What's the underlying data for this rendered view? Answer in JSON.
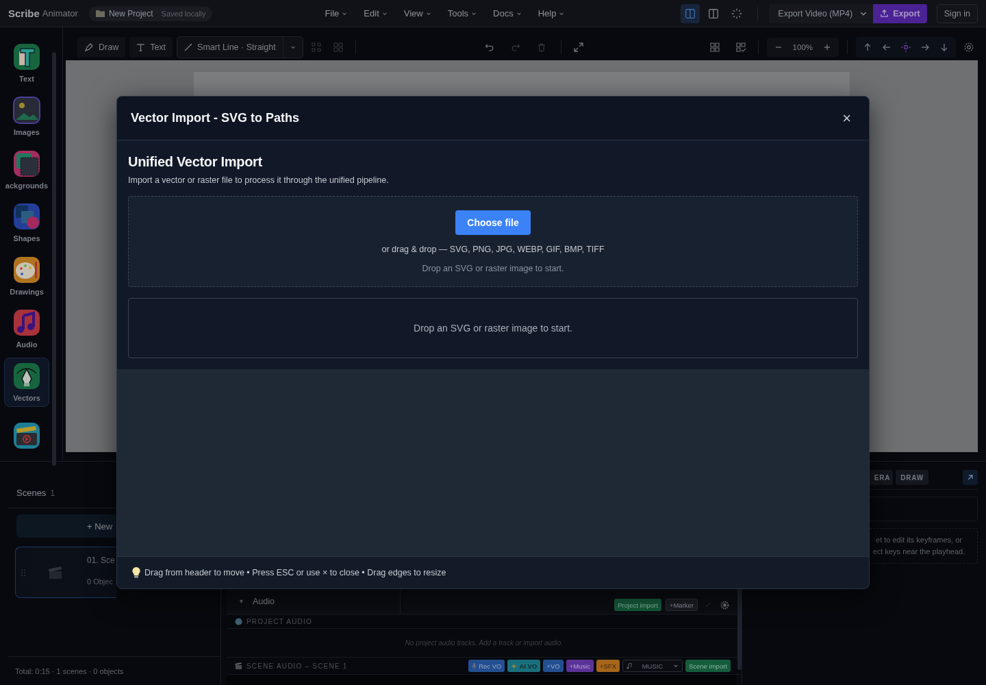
{
  "header": {
    "brand": "Scribe",
    "brand_sub": "Animator",
    "project": "New Project",
    "project_status": "Saved locally",
    "menus": [
      "File",
      "Edit",
      "View",
      "Tools",
      "Docs",
      "Help"
    ],
    "layout_buttons": [
      {
        "kind": "split",
        "selected": true
      },
      {
        "kind": "columns",
        "selected": false
      },
      {
        "kind": "loader",
        "selected": false
      }
    ],
    "export_format": "Export Video (MP4)",
    "export_button": "Export",
    "sign_in": "Sign in"
  },
  "toolbar": {
    "tools": [
      {
        "kind": "draw",
        "label": "Draw"
      },
      {
        "kind": "text",
        "label": "Text"
      }
    ],
    "smart_line": "Smart Line · Straight",
    "history": [
      {
        "kind": "undo",
        "disabled": false
      },
      {
        "kind": "redo",
        "disabled": true
      },
      {
        "kind": "delete",
        "disabled": true
      }
    ],
    "zoom": "100%"
  },
  "sidebar": {
    "items": [
      {
        "kind": "text",
        "label": "Text",
        "selected": false
      },
      {
        "kind": "images",
        "label": "Images",
        "selected": false
      },
      {
        "kind": "backgrounds",
        "label": "ackgrounds",
        "selected": false
      },
      {
        "kind": "shapes",
        "label": "Shapes",
        "selected": false
      },
      {
        "kind": "drawings",
        "label": "Drawings",
        "selected": false
      },
      {
        "kind": "audio",
        "label": "Audio",
        "selected": false
      },
      {
        "kind": "vectors",
        "label": "Vectors",
        "selected": true
      },
      {
        "kind": "video",
        "selected": false
      }
    ]
  },
  "scenes": {
    "title": "Scenes",
    "count": "1",
    "new_button": "+ New",
    "cards": [
      {
        "number": "01.",
        "title": "Sce",
        "objects": "0 Objec",
        "selected": true
      }
    ],
    "total": "Total: 0:15 · 1 scenes · 0 objects"
  },
  "timeline": {
    "audio_label": "Audio",
    "expander": "▼",
    "audio_buttons": [
      {
        "kind": "import",
        "label": "Project import"
      },
      {
        "kind": "marker",
        "label": "+Marker"
      }
    ],
    "project_audio": "PROJECT AUDIO",
    "empty_message": "No project audio tracks. Add a track or import audio.",
    "scene_audio": "SCENE AUDIO – SCENE 1",
    "scene_buttons": [
      {
        "kind": "record",
        "label": "Rec VO"
      },
      {
        "kind": "ai",
        "label": "AI VO"
      },
      {
        "kind": "vo",
        "label": "+VO"
      },
      {
        "kind": "music",
        "label": "+Music"
      },
      {
        "kind": "sfx",
        "label": "+SFX"
      },
      {
        "kind": "select",
        "label": "MUSIC"
      },
      {
        "kind": "import",
        "label": "Scene import"
      }
    ]
  },
  "inspector": {
    "tabs": [
      {
        "label": "ERA",
        "selected": false
      },
      {
        "label": "DRAW",
        "selected": false
      }
    ],
    "hint_lines": [
      "et to edit its keyframes, or",
      "ect keys near the playhead."
    ]
  },
  "dialog": {
    "title": "Vector Import - SVG to Paths",
    "close": "×",
    "section_title": "Unified Vector Import",
    "section_description": "Import a vector or raster file to process it through the unified pipeline.",
    "choose_file": "Choose file",
    "formats": "or drag & drop — SVG, PNG, JPG, WEBP, GIF, BMP, TIFF",
    "drop_hint": "Drop an SVG or raster image to start.",
    "preview_hint": "Drop an SVG or raster image to start.",
    "footer": "Drag from header to move • Press ESC or use × to close • Drag edges to resize"
  }
}
